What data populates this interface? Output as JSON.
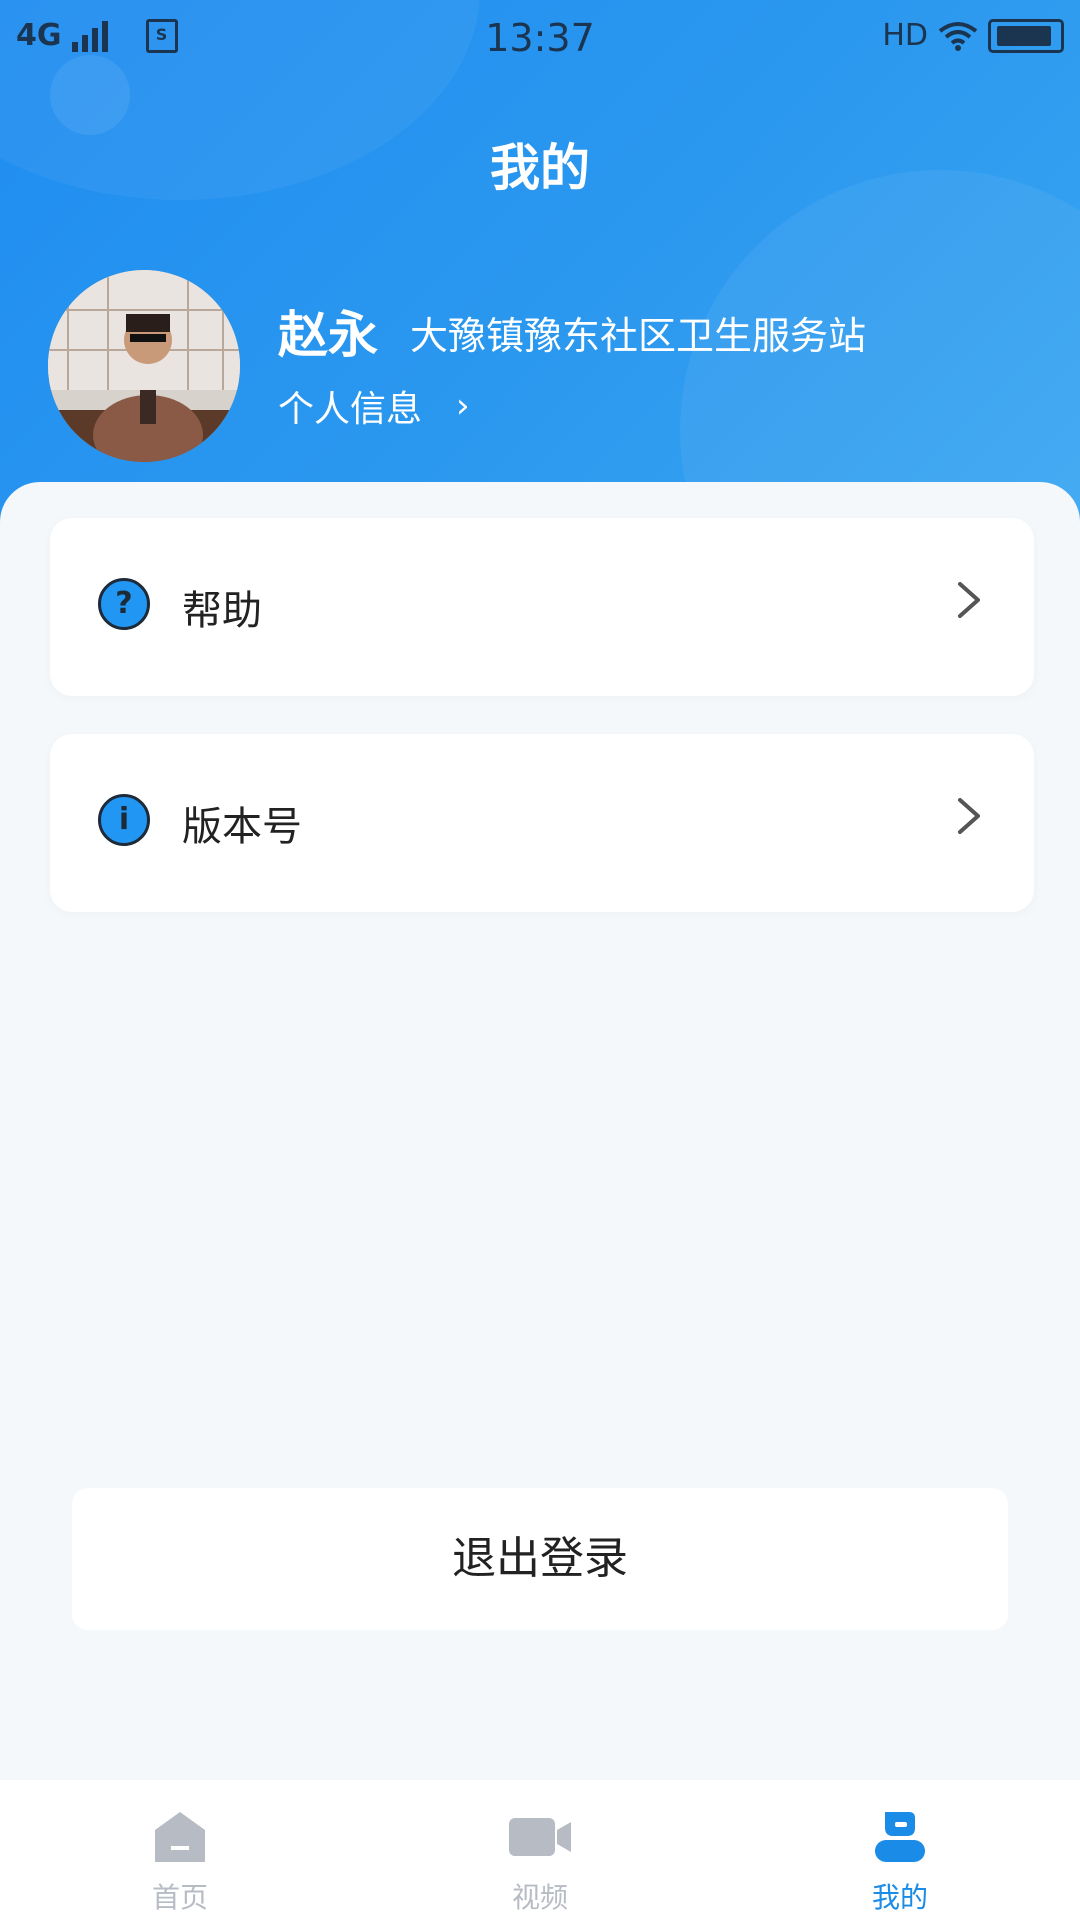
{
  "status_bar": {
    "network": "4G",
    "time": "13:37",
    "hd": "HD"
  },
  "header": {
    "title": "我的"
  },
  "profile": {
    "name": "赵永",
    "organization": "大豫镇豫东社区卫生服务站",
    "info_link": "个人信息"
  },
  "menu": {
    "items": [
      {
        "label": "帮助",
        "icon": "help-icon"
      },
      {
        "label": "版本号",
        "icon": "info-icon"
      }
    ]
  },
  "logout": {
    "label": "退出登录"
  },
  "tabbar": {
    "tabs": [
      {
        "label": "首页",
        "icon": "home-icon",
        "active": false
      },
      {
        "label": "视频",
        "icon": "video-camera-icon",
        "active": false
      },
      {
        "label": "我的",
        "icon": "user-icon",
        "active": true
      }
    ]
  },
  "colors": {
    "header_blue": "#1f8df0",
    "accent": "#1a8be6",
    "inactive": "#b7bcc4"
  }
}
